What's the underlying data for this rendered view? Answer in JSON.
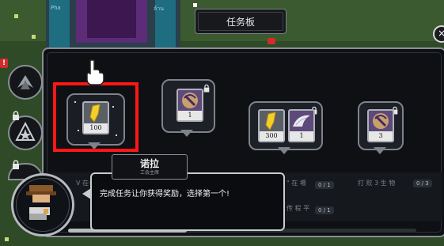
{
  "board": {
    "title": "任务板"
  },
  "side_tabs": [
    {
      "name": "tab-achievements",
      "locked": false
    },
    {
      "name": "tab-ranks",
      "locked": true
    },
    {
      "name": "tab-extra",
      "locked": true
    }
  ],
  "alert_badge": "!",
  "top_close": "×",
  "rewards": [
    {
      "items": [
        {
          "icon": "gold-shard-icon",
          "count": "100"
        }
      ],
      "locked": false,
      "selected": true
    },
    {
      "items": [
        {
          "icon": "pickaxe-token-icon",
          "count": "1"
        }
      ],
      "locked": true,
      "selected": false
    },
    {
      "items": [
        {
          "icon": "gold-shard-icon",
          "count": "300"
        },
        {
          "icon": "wing-feather-icon",
          "count": "1"
        }
      ],
      "locked": true,
      "selected": false
    },
    {
      "items": [
        {
          "icon": "pickaxe-token-icon",
          "count": "3"
        }
      ],
      "locked": true,
      "selected": false
    }
  ],
  "background_rows": {
    "left_text": "V 在一",
    "mid_text_1": "\" 在 場",
    "mid_text_2": "传 程 平",
    "right_text": "打 败 3 生 物",
    "badge_1": "0 / 1",
    "badge_2": "0 / 1",
    "badge_3": "0 / 3",
    "sign_left": "Pha",
    "sign_right": "ล้าน"
  },
  "npc": {
    "name": "诺拉",
    "title": "工会主席",
    "dialog": "完成任务让你获得奖励，选择第一个!"
  },
  "colors": {
    "highlight": "#ff1616",
    "panel_border": "#8a8e96",
    "alert": "#d22b2b"
  }
}
